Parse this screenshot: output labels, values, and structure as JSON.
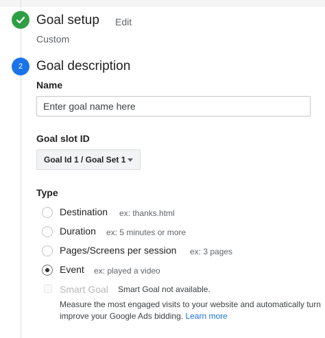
{
  "step1": {
    "number": "✓",
    "title": "Goal setup",
    "edit_label": "Edit",
    "subtitle": "Custom",
    "status_color": "#2e9e44"
  },
  "step2": {
    "number": "2",
    "title": "Goal description",
    "status_color": "#1a73e8"
  },
  "name_field": {
    "label": "Name",
    "placeholder": "Enter goal name here",
    "value": ""
  },
  "goal_slot": {
    "label": "Goal slot ID",
    "selected": "Goal Id 1 / Goal Set 1"
  },
  "type": {
    "label": "Type",
    "options": [
      {
        "label": "Destination",
        "hint": "ex: thanks.html",
        "checked": false
      },
      {
        "label": "Duration",
        "hint": "ex: 5 minutes or more",
        "checked": false
      },
      {
        "label": "Pages/Screens per session",
        "hint": "ex: 3 pages",
        "checked": false
      },
      {
        "label": "Event",
        "hint": "ex: played a video",
        "checked": true
      }
    ]
  },
  "smart_goal": {
    "label": "Smart Goal",
    "hint": "Smart Goal not available.",
    "description_line1": "Measure the most engaged visits to your website and automatically turn",
    "description_line2": "improve your Google Ads bidding.",
    "learn_more": "Learn more"
  }
}
